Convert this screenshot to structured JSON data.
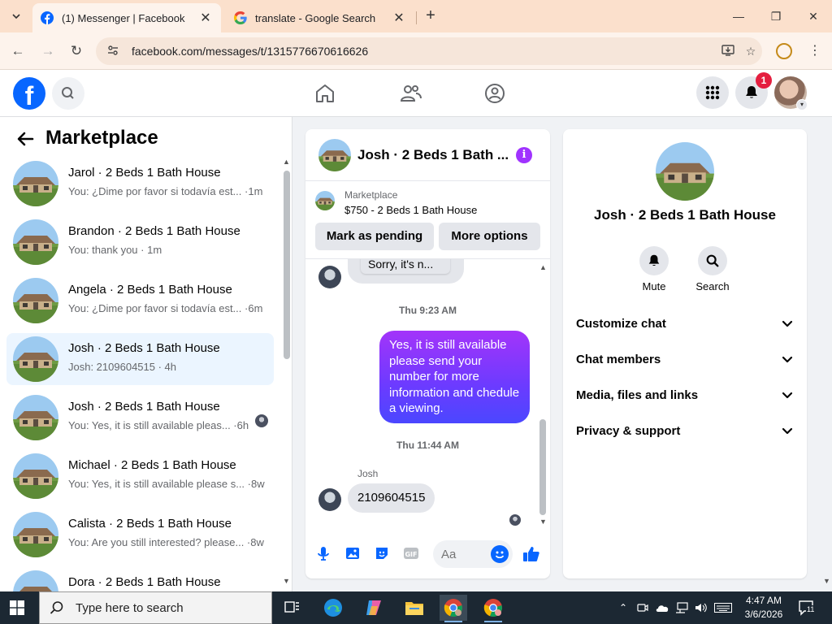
{
  "browser": {
    "tabs": [
      {
        "title": "(1) Messenger | Facebook",
        "active": true
      },
      {
        "title": "translate - Google Search",
        "active": false
      }
    ],
    "url": "facebook.com/messages/t/1315776670616626"
  },
  "header": {
    "notification_count": "1"
  },
  "sidebar": {
    "title": "Marketplace",
    "conversations": [
      {
        "name": "Jarol · 2 Beds 1 Bath House",
        "snippet": "You: ¿Dime por favor si todavía est... ·1m",
        "selected": false,
        "seen": false
      },
      {
        "name": "Brandon · 2 Beds 1 Bath House",
        "snippet": "You: thank you · 1m",
        "selected": false,
        "seen": false
      },
      {
        "name": "Angela · 2 Beds 1 Bath House",
        "snippet": "You: ¿Dime por favor si todavía est... ·6m",
        "selected": false,
        "seen": false
      },
      {
        "name": "Josh · 2 Beds 1 Bath House",
        "snippet": "Josh: 2109604515 · 4h",
        "selected": true,
        "seen": false
      },
      {
        "name": "Josh · 2 Beds 1 Bath House",
        "snippet": "You: Yes, it is still available pleas... ·6h",
        "selected": false,
        "seen": true
      },
      {
        "name": "Michael · 2 Beds 1 Bath House",
        "snippet": "You: Yes, it is still available please s... ·8w",
        "selected": false,
        "seen": false
      },
      {
        "name": "Calista · 2 Beds 1 Bath House",
        "snippet": "You: Are you still interested? please... ·8w",
        "selected": false,
        "seen": false
      },
      {
        "name": "Dora · 2 Beds 1 Bath House",
        "snippet": "",
        "selected": false,
        "seen": false
      }
    ]
  },
  "chat": {
    "title": "Josh · 2 Beds 1 Bath ...",
    "listing_label": "Marketplace",
    "listing_price": "$750 - 2 Beds 1 Bath House",
    "mark_pending": "Mark as pending",
    "more_options": "More options",
    "partial_bubble": "Sorry, it's n...",
    "timestamp_1": "Thu 9:23 AM",
    "my_message": "Yes, it is still available please send your number for more information and chedule a viewing.",
    "timestamp_2": "Thu 11:44 AM",
    "sender_name": "Josh",
    "their_message": "2109604515",
    "composer_placeholder": "Aa"
  },
  "info_panel": {
    "title": "Josh · 2 Beds 1 Bath House",
    "actions": [
      {
        "label": "Mute",
        "icon": "bell-icon"
      },
      {
        "label": "Search",
        "icon": "search-icon"
      }
    ],
    "sections": [
      "Customize chat",
      "Chat members",
      "Media, files and links",
      "Privacy & support"
    ]
  },
  "taskbar": {
    "search_placeholder": "Type here to search",
    "time": "4:47 AM",
    "date": "3/6/2026",
    "notification_count": "11"
  },
  "colors": {
    "accent_blue": "#0866ff",
    "bubble_purple": "#8a38fb",
    "tab_strip": "#fbe0cc"
  }
}
